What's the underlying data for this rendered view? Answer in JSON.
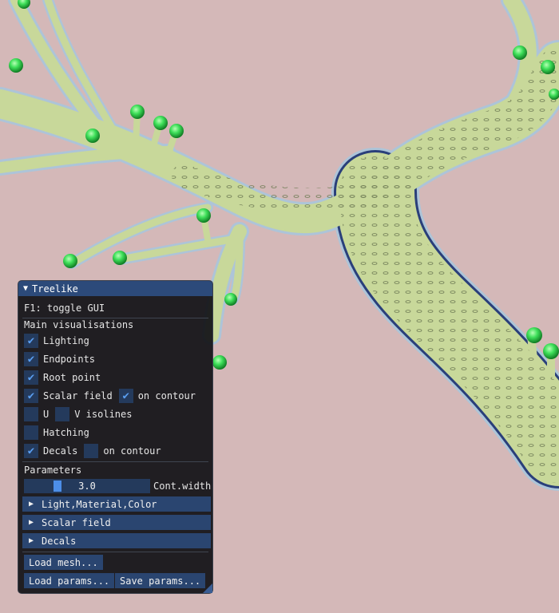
{
  "window": {
    "title": "Treelike",
    "hint": "F1: toggle GUI"
  },
  "main_vis": {
    "heading": "Main visualisations",
    "lighting": {
      "label": "Lighting",
      "checked": true
    },
    "endpoints": {
      "label": "Endpoints",
      "checked": true
    },
    "root_point": {
      "label": "Root point",
      "checked": true
    },
    "scalar_field": {
      "label": "Scalar field",
      "checked": true
    },
    "scalar_on_contour": {
      "label": "on contour",
      "checked": true
    },
    "u_isolines": {
      "label": "U",
      "checked": false
    },
    "v_isolines": {
      "label": "V isolines",
      "checked": false
    },
    "hatching": {
      "label": "Hatching",
      "checked": false
    },
    "decals": {
      "label": "Decals",
      "checked": true
    },
    "decals_on_contour": {
      "label": "on contour",
      "checked": false
    }
  },
  "parameters": {
    "heading": "Parameters",
    "cont_width": {
      "value": "3.0",
      "label": "Cont.width",
      "fraction": 0.25
    }
  },
  "headers": {
    "light": "Light,Material,Color",
    "scalar": "Scalar field",
    "decals": "Decals"
  },
  "buttons": {
    "load_mesh": "Load mesh...",
    "load_params": "Load params...",
    "save_params": "Save params..."
  },
  "icons": {
    "collapse": "triangle-down-icon",
    "expand": "triangle-right-icon",
    "check": "checkmark-icon"
  },
  "colors": {
    "background": "#d4b8b8",
    "branch_fill": "#c8d89a",
    "branch_outline": "#2a3f7a",
    "endpoint": "#3fe05a",
    "accent": "#4d8ee8"
  }
}
